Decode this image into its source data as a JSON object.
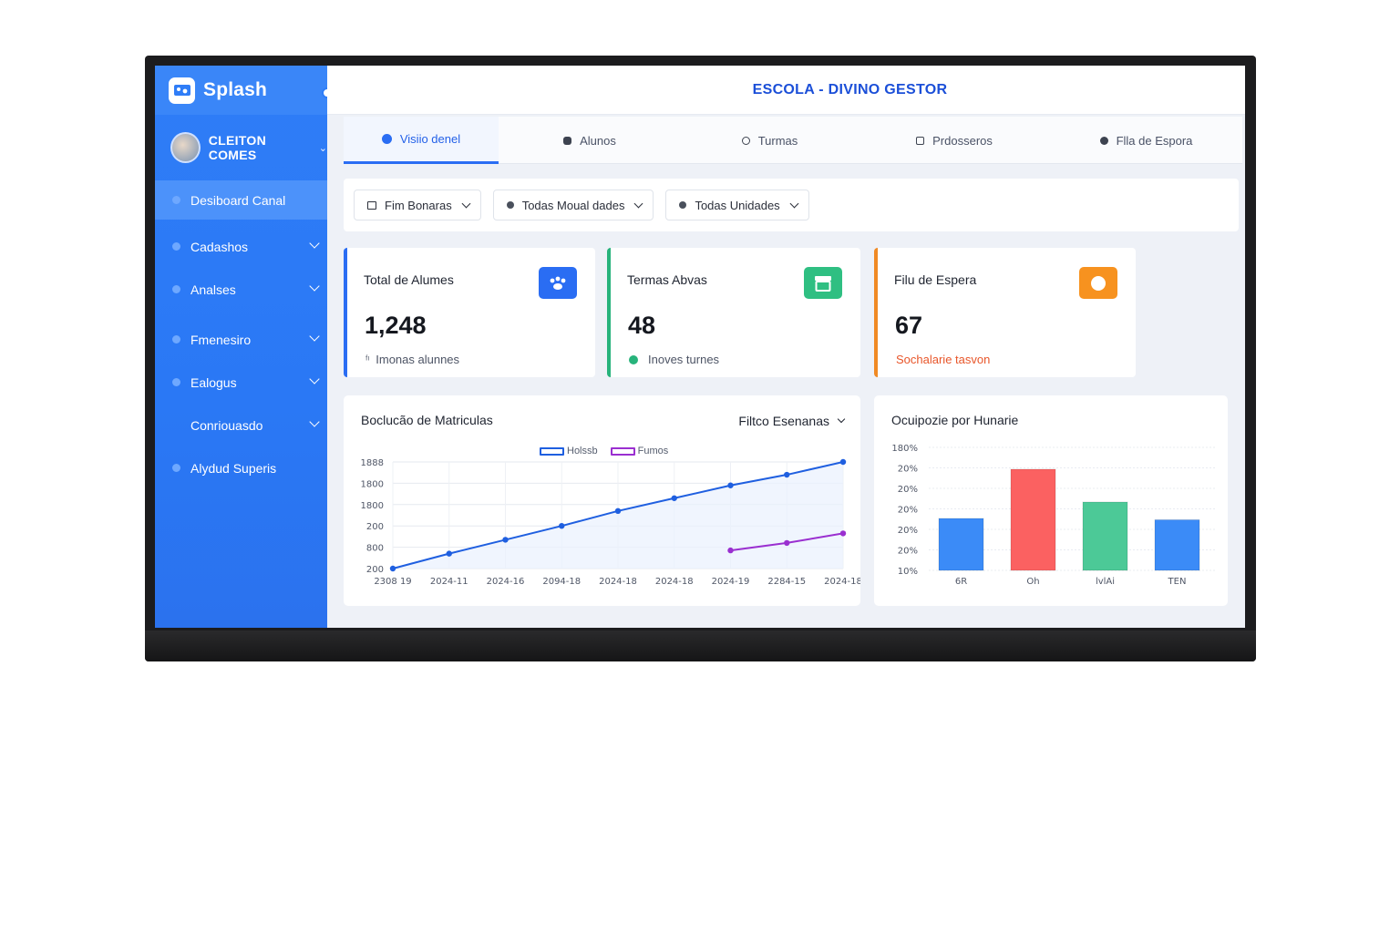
{
  "brand": {
    "name": "Splash"
  },
  "user": {
    "name": "CLEITON COMES"
  },
  "sidebar": {
    "items": [
      {
        "label": "Desiboard Canal",
        "active": true,
        "dot": true,
        "chevron": false
      },
      {
        "label": "Cadashos",
        "active": false,
        "dot": true,
        "chevron": true
      },
      {
        "label": "Analses",
        "active": false,
        "dot": true,
        "chevron": true
      },
      {
        "label": "Fmenesiro",
        "active": false,
        "dot": true,
        "chevron": true
      },
      {
        "label": "Ealogus",
        "active": false,
        "dot": true,
        "chevron": true
      },
      {
        "label": "Conriouasdo",
        "active": false,
        "dot": false,
        "chevron": true
      },
      {
        "label": "Alydud Superis",
        "active": false,
        "dot": true,
        "chevron": false
      }
    ]
  },
  "header": {
    "title": "ESCOLA - DIVINO GESTOR"
  },
  "tabs": [
    {
      "label": "Visiio denel",
      "icon": "circle-icon",
      "active": true
    },
    {
      "label": "Alunos",
      "icon": "student-icon",
      "active": false
    },
    {
      "label": "Turmas",
      "icon": "class-icon",
      "active": false
    },
    {
      "label": "Prdosseros",
      "icon": "teacher-icon",
      "active": false
    },
    {
      "label": "Flla de Espora",
      "icon": "queue-icon",
      "active": false
    }
  ],
  "filters": [
    {
      "label": "Fim Bonaras",
      "icon": "calendar-icon"
    },
    {
      "label": "Todas Moual dades",
      "icon": "modality-icon"
    },
    {
      "label": "Todas Unidades",
      "icon": "unit-icon"
    }
  ],
  "cards": [
    {
      "label": "Total de Alumes",
      "value": "1,248",
      "sub": "Imonas alunnes",
      "accent": "#2a6df3",
      "icon_color": "#2a6df3",
      "icon": "paw-icon",
      "sub_color": "#4d5465"
    },
    {
      "label": "Termas Abvas",
      "value": "48",
      "sub": "Inoves turnes",
      "accent": "#27b37b",
      "icon_color": "#2fbf82",
      "icon": "box-icon",
      "sub_color": "#4d5465"
    },
    {
      "label": "Filu de Espera",
      "value": "67",
      "sub": "Sochalarie tasvon",
      "accent": "#f08a24",
      "icon_color": "#f7921f",
      "icon": "circle-badge-icon",
      "sub_color": "#e8562a"
    }
  ],
  "line_panel": {
    "title": "Boclucão de Matriculas",
    "filter_label": "Filtco  Esenanas"
  },
  "bar_panel": {
    "title": "Ocuipozie por Hunarie"
  },
  "chart_data": [
    {
      "type": "line",
      "title": "Boclucão de Matriculas",
      "x": [
        "2308 19",
        "2024-11",
        "2024-16",
        "2094-18",
        "2024-18",
        "2024-18",
        "2024-19",
        "2284-15",
        "2024-18"
      ],
      "y_tick_labels": [
        "1888",
        "1800",
        "1800",
        "200",
        "800",
        "200"
      ],
      "series": [
        {
          "name": "Holssb",
          "color": "#1f5fe0",
          "values": [
            0,
            14,
            27,
            40,
            54,
            66,
            78,
            88,
            100
          ]
        },
        {
          "name": "Fumos",
          "color": "#9a2fd0",
          "values": [
            null,
            null,
            null,
            null,
            null,
            null,
            17,
            24,
            33
          ]
        }
      ],
      "grid": true,
      "legend": "top-center"
    },
    {
      "type": "bar",
      "title": "Ocuipozie por Hunarie",
      "categories": [
        "6R",
        "Oh",
        "lvlAi",
        "TEN"
      ],
      "values": [
        38,
        74,
        50,
        37
      ],
      "colors": [
        "#3b8bf7",
        "#fb6161",
        "#4cc997",
        "#3b8bf7"
      ],
      "y_tick_labels": [
        "180%",
        "20%",
        "20%",
        "20%",
        "20%",
        "20%",
        "10%"
      ],
      "ylim": [
        0,
        90
      ],
      "grid": true
    }
  ]
}
